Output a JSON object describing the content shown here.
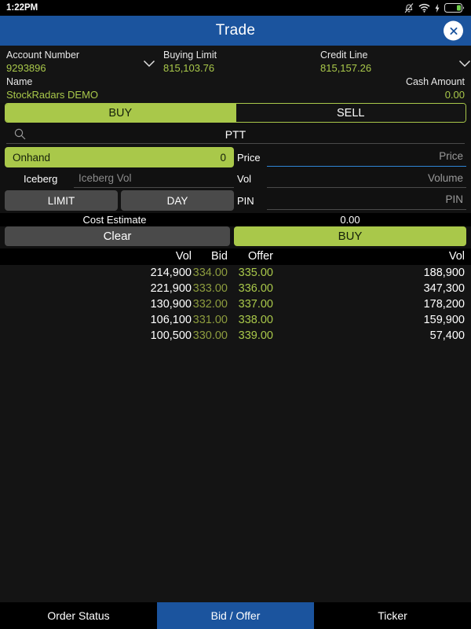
{
  "statusbar": {
    "time": "1:22PM",
    "icons": [
      "mute-bell-icon",
      "wifi-icon",
      "charging-bolt-icon",
      "battery-icon"
    ]
  },
  "header": {
    "title": "Trade",
    "close_icon": "close-icon"
  },
  "account": {
    "account_number_label": "Account Number",
    "account_number_value": "9293896",
    "buying_limit_label": "Buying Limit",
    "buying_limit_value": "815,103.76",
    "credit_line_label": "Credit Line",
    "credit_line_value": "815,157.26",
    "name_label": "Name",
    "name_value": "StockRadars DEMO",
    "cash_amount_label": "Cash Amount",
    "cash_amount_value": "0.00",
    "chevron_icon": "chevron-down-icon"
  },
  "side_selector": {
    "buy_label": "BUY",
    "sell_label": "SELL",
    "active": "BUY"
  },
  "symbol_search": {
    "search_icon": "search-icon",
    "symbol": "PTT"
  },
  "order_form": {
    "onhand_label": "Onhand",
    "onhand_value": "0",
    "price_label": "Price",
    "price_value": "",
    "price_placeholder": "Price",
    "iceberg_label": "Iceberg",
    "iceberg_value": "",
    "iceberg_placeholder": "Iceberg Vol",
    "vol_label": "Vol",
    "vol_value": "",
    "vol_placeholder": "Volume",
    "order_type_label": "LIMIT",
    "validity_label": "DAY",
    "pin_label": "PIN",
    "pin_value": "",
    "pin_placeholder": "PIN",
    "cost_estimate_label": "Cost Estimate",
    "cost_estimate_value": "0.00",
    "clear_label": "Clear",
    "submit_label": "BUY"
  },
  "bid_offer": {
    "headers": {
      "bid_vol": "Vol",
      "bid": "Bid",
      "offer": "Offer",
      "offer_vol": "Vol"
    },
    "rows": [
      {
        "bid_vol": "214,900",
        "bid": "334.00",
        "offer": "335.00",
        "offer_vol": "188,900"
      },
      {
        "bid_vol": "221,900",
        "bid": "333.00",
        "offer": "336.00",
        "offer_vol": "347,300"
      },
      {
        "bid_vol": "130,900",
        "bid": "332.00",
        "offer": "337.00",
        "offer_vol": "178,200"
      },
      {
        "bid_vol": "106,100",
        "bid": "331.00",
        "offer": "338.00",
        "offer_vol": "159,900"
      },
      {
        "bid_vol": "100,500",
        "bid": "330.00",
        "offer": "339.00",
        "offer_vol": "57,400"
      }
    ]
  },
  "tabs": {
    "items": [
      {
        "label": "Order Status",
        "active": false
      },
      {
        "label": "Bid / Offer",
        "active": true
      },
      {
        "label": "Ticker",
        "active": false
      }
    ]
  },
  "colors": {
    "accent_green": "#a9c84a",
    "header_blue": "#1b549e",
    "focus_blue": "#2f86d6",
    "background": "#141414"
  }
}
